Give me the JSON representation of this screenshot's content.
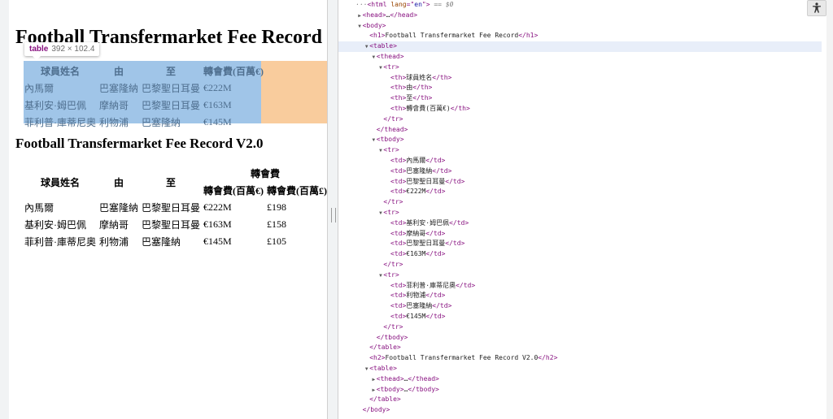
{
  "page": {
    "h1": "Football Transfermarket Fee Record",
    "h2": "Football Transfermarket Fee Record V2.0"
  },
  "tooltip": {
    "tag": "table",
    "dims": "392 × 102.4"
  },
  "table1": {
    "headers": [
      "球員姓名",
      "由",
      "至",
      "轉會費(百萬€)"
    ],
    "rows": [
      [
        "內馬爾",
        "巴塞隆納",
        "巴黎聖日耳曼",
        "€222M"
      ],
      [
        "基利安·姆巴佩",
        "摩納哥",
        "巴黎聖日耳曼",
        "€163M"
      ],
      [
        "菲利普·庫蒂尼奧",
        "利物浦",
        "巴塞隆納",
        "€145M"
      ]
    ]
  },
  "table2": {
    "headers": [
      "球員姓名",
      "由",
      "至",
      "轉會費"
    ],
    "subheaders": [
      "轉會費(百萬€)",
      "轉會費(百萬£)"
    ],
    "rows": [
      [
        "內馬爾",
        "巴塞隆納",
        "巴黎聖日耳曼",
        "€222M",
        "£198"
      ],
      [
        "基利安·姆巴佩",
        "摩納哥",
        "巴黎聖日耳曼",
        "€163M",
        "£158"
      ],
      [
        "菲利普·庫蒂尼奧",
        "利物浦",
        "巴塞隆納",
        "€145M",
        "£105"
      ]
    ]
  },
  "devtools": {
    "lines": [
      {
        "indent": 0,
        "tw": "",
        "segs": [
          [
            "dim",
            "···"
          ],
          [
            "tg",
            "<html "
          ],
          [
            "at",
            "lang"
          ],
          [
            "tg",
            "=\""
          ],
          [
            "av",
            "en"
          ],
          [
            "tg",
            "\">"
          ],
          [
            "dim",
            " == $0"
          ]
        ]
      },
      {
        "indent": 1,
        "tw": "▶",
        "segs": [
          [
            "tg",
            "<head>"
          ],
          [
            "tx",
            "…"
          ],
          [
            "tg",
            "</head>"
          ]
        ]
      },
      {
        "indent": 1,
        "tw": "▼",
        "segs": [
          [
            "tg",
            "<body>"
          ]
        ]
      },
      {
        "indent": 2,
        "tw": "",
        "segs": [
          [
            "tg",
            "<h1>"
          ],
          [
            "tx",
            "Football Transfermarket Fee Record"
          ],
          [
            "tg",
            "</h1>"
          ]
        ]
      },
      {
        "indent": 2,
        "tw": "▼",
        "sel": true,
        "segs": [
          [
            "tg",
            "<table>"
          ]
        ]
      },
      {
        "indent": 3,
        "tw": "▼",
        "segs": [
          [
            "tg",
            "<thead>"
          ]
        ]
      },
      {
        "indent": 4,
        "tw": "▼",
        "segs": [
          [
            "tg",
            "<tr>"
          ]
        ]
      },
      {
        "indent": 5,
        "tw": "",
        "segs": [
          [
            "tg",
            "<th>"
          ],
          [
            "tx",
            "球員姓名"
          ],
          [
            "tg",
            "</th>"
          ]
        ]
      },
      {
        "indent": 5,
        "tw": "",
        "segs": [
          [
            "tg",
            "<th>"
          ],
          [
            "tx",
            "由"
          ],
          [
            "tg",
            "</th>"
          ]
        ]
      },
      {
        "indent": 5,
        "tw": "",
        "segs": [
          [
            "tg",
            "<th>"
          ],
          [
            "tx",
            "至"
          ],
          [
            "tg",
            "</th>"
          ]
        ]
      },
      {
        "indent": 5,
        "tw": "",
        "segs": [
          [
            "tg",
            "<th>"
          ],
          [
            "tx",
            "轉會費(百萬€)"
          ],
          [
            "tg",
            "</th>"
          ]
        ]
      },
      {
        "indent": 4,
        "tw": "",
        "segs": [
          [
            "tg",
            "</tr>"
          ]
        ]
      },
      {
        "indent": 3,
        "tw": "",
        "segs": [
          [
            "tg",
            "</thead>"
          ]
        ]
      },
      {
        "indent": 3,
        "tw": "▼",
        "segs": [
          [
            "tg",
            "<tbody>"
          ]
        ]
      },
      {
        "indent": 4,
        "tw": "▼",
        "segs": [
          [
            "tg",
            "<tr>"
          ]
        ]
      },
      {
        "indent": 5,
        "tw": "",
        "segs": [
          [
            "tg",
            "<td>"
          ],
          [
            "tx",
            "內馬爾"
          ],
          [
            "tg",
            "</td>"
          ]
        ]
      },
      {
        "indent": 5,
        "tw": "",
        "segs": [
          [
            "tg",
            "<td>"
          ],
          [
            "tx",
            "巴塞隆納"
          ],
          [
            "tg",
            "</td>"
          ]
        ]
      },
      {
        "indent": 5,
        "tw": "",
        "segs": [
          [
            "tg",
            "<td>"
          ],
          [
            "tx",
            "巴黎聖日耳曼"
          ],
          [
            "tg",
            "</td>"
          ]
        ]
      },
      {
        "indent": 5,
        "tw": "",
        "segs": [
          [
            "tg",
            "<td>"
          ],
          [
            "tx",
            "€222M"
          ],
          [
            "tg",
            "</td>"
          ]
        ]
      },
      {
        "indent": 4,
        "tw": "",
        "segs": [
          [
            "tg",
            "</tr>"
          ]
        ]
      },
      {
        "indent": 4,
        "tw": "▼",
        "segs": [
          [
            "tg",
            "<tr>"
          ]
        ]
      },
      {
        "indent": 5,
        "tw": "",
        "segs": [
          [
            "tg",
            "<td>"
          ],
          [
            "tx",
            "基利安·姆巴佩"
          ],
          [
            "tg",
            "</td>"
          ]
        ]
      },
      {
        "indent": 5,
        "tw": "",
        "segs": [
          [
            "tg",
            "<td>"
          ],
          [
            "tx",
            "摩納哥"
          ],
          [
            "tg",
            "</td>"
          ]
        ]
      },
      {
        "indent": 5,
        "tw": "",
        "segs": [
          [
            "tg",
            "<td>"
          ],
          [
            "tx",
            "巴黎聖日耳曼"
          ],
          [
            "tg",
            "</td>"
          ]
        ]
      },
      {
        "indent": 5,
        "tw": "",
        "segs": [
          [
            "tg",
            "<td>"
          ],
          [
            "tx",
            "€163M"
          ],
          [
            "tg",
            "</td>"
          ]
        ]
      },
      {
        "indent": 4,
        "tw": "",
        "segs": [
          [
            "tg",
            "</tr>"
          ]
        ]
      },
      {
        "indent": 4,
        "tw": "▼",
        "segs": [
          [
            "tg",
            "<tr>"
          ]
        ]
      },
      {
        "indent": 5,
        "tw": "",
        "segs": [
          [
            "tg",
            "<td>"
          ],
          [
            "tx",
            "菲利普·庫蒂尼奧"
          ],
          [
            "tg",
            "</td>"
          ]
        ]
      },
      {
        "indent": 5,
        "tw": "",
        "segs": [
          [
            "tg",
            "<td>"
          ],
          [
            "tx",
            "利物浦"
          ],
          [
            "tg",
            "</td>"
          ]
        ]
      },
      {
        "indent": 5,
        "tw": "",
        "segs": [
          [
            "tg",
            "<td>"
          ],
          [
            "tx",
            "巴塞隆納"
          ],
          [
            "tg",
            "</td>"
          ]
        ]
      },
      {
        "indent": 5,
        "tw": "",
        "segs": [
          [
            "tg",
            "<td>"
          ],
          [
            "tx",
            "€145M"
          ],
          [
            "tg",
            "</td>"
          ]
        ]
      },
      {
        "indent": 4,
        "tw": "",
        "segs": [
          [
            "tg",
            "</tr>"
          ]
        ]
      },
      {
        "indent": 3,
        "tw": "",
        "segs": [
          [
            "tg",
            "</tbody>"
          ]
        ]
      },
      {
        "indent": 2,
        "tw": "",
        "segs": [
          [
            "tg",
            "</table>"
          ]
        ]
      },
      {
        "indent": 2,
        "tw": "",
        "segs": [
          [
            "tg",
            "<h2>"
          ],
          [
            "tx",
            "Football Transfermarket Fee Record V2.0"
          ],
          [
            "tg",
            "</h2>"
          ]
        ]
      },
      {
        "indent": 2,
        "tw": "▼",
        "segs": [
          [
            "tg",
            "<table>"
          ]
        ]
      },
      {
        "indent": 3,
        "tw": "▶",
        "segs": [
          [
            "tg",
            "<thead>"
          ],
          [
            "tx",
            "…"
          ],
          [
            "tg",
            "</thead>"
          ]
        ]
      },
      {
        "indent": 3,
        "tw": "▶",
        "segs": [
          [
            "tg",
            "<tbody>"
          ],
          [
            "tx",
            "…"
          ],
          [
            "tg",
            "</tbody>"
          ]
        ]
      },
      {
        "indent": 2,
        "tw": "",
        "segs": [
          [
            "tg",
            "</table>"
          ]
        ]
      },
      {
        "indent": 1,
        "tw": "",
        "segs": [
          [
            "tg",
            "</body>"
          ]
        ]
      }
    ]
  }
}
